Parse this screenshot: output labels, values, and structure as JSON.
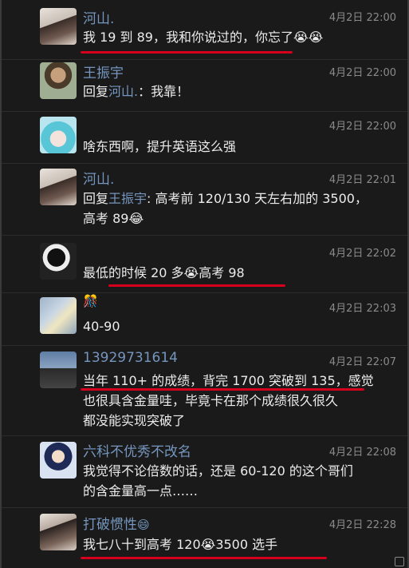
{
  "comments": [
    {
      "name": "河山.",
      "time": "4月2日 22:00",
      "text": "我 19 到 89，我和你说过的，你忘了😭😭"
    },
    {
      "name": "王振宇",
      "time": "4月2日 22:00",
      "reply_prefix": "回复",
      "reply_to": "河山.",
      "text": "：我靠！"
    },
    {
      "name": "",
      "time": "4月2日 22:00",
      "text": "啥东西啊，提升英语这么强"
    },
    {
      "name": "河山.",
      "time": "4月2日 22:01",
      "reply_prefix": "回复",
      "reply_to": "王振宇",
      "text": ": 高考前 120/130 天左右加的 3500，",
      "text2": "高考 89😂"
    },
    {
      "name": "",
      "time": "4月2日 22:02",
      "text": "最低的时候 20 多😭高考 98"
    },
    {
      "name": "",
      "badge": "🎊",
      "time": "4月2日 22:03",
      "text": "40-90"
    },
    {
      "name": "13929731614",
      "time": "4月2日 22:07",
      "lines": [
        "当年 110+ 的成绩，背完 1700 突破到 135，感觉",
        "也很具含金量哇，毕竟卡在那个成绩很久很久",
        "都没能实现突破了"
      ]
    },
    {
      "name": "六科不优秀不改名",
      "time": "4月2日 22:08",
      "lines": [
        "我觉得不论倍数的话，还是 60-120 的这个哥们",
        "的含金量高一点……"
      ]
    },
    {
      "name": "打破惯性",
      "name_emoji": "😄",
      "time": "4月2日 22:28",
      "text": "我七八十到高考 120😭3500 选手"
    }
  ]
}
